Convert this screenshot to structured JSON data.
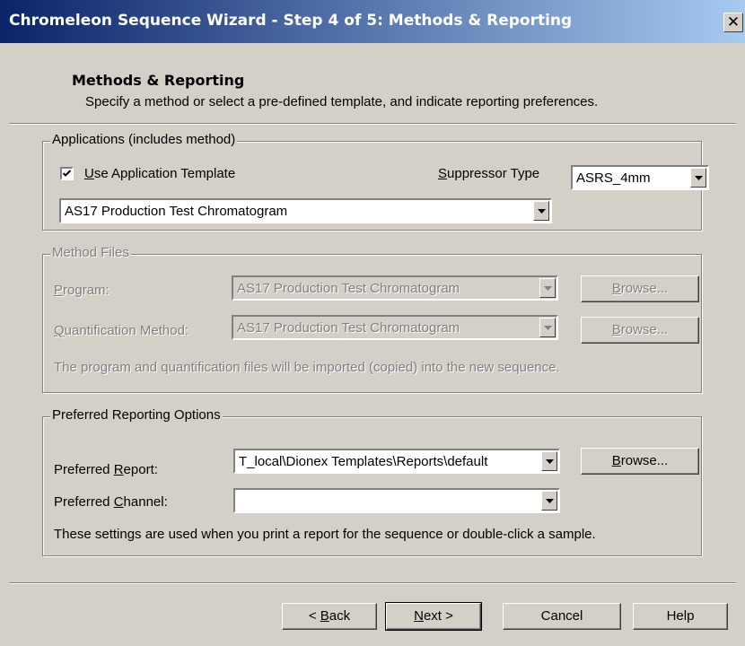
{
  "window": {
    "title": "Chromeleon Sequence Wizard - Step 4 of 5: Methods & Reporting",
    "close_glyph": "✕"
  },
  "header": {
    "title": "Methods & Reporting",
    "subtitle": "Specify a method or select a pre-defined template, and indicate reporting preferences."
  },
  "applications": {
    "legend": "Applications (includes method)",
    "use_template_label_u": "U",
    "use_template_label_rest": "se Application Template",
    "use_template_checked": true,
    "suppressor_label_u": "S",
    "suppressor_label_rest": "uppressor Type",
    "suppressor_value": "ASRS_4mm",
    "template_value": "AS17 Production Test Chromatogram"
  },
  "method_files": {
    "legend": "Method Files",
    "program_label_u": "P",
    "program_label_rest": "rogram:",
    "program_value": "AS17 Production Test Chromatogram",
    "quant_label_u": "Q",
    "quant_label_rest": "uantification Method:",
    "quant_value": "AS17 Production Test Chromatogram",
    "browse_u": "B",
    "browse_rest": "rowse...",
    "note": "The program and quantification files will be imported (copied) into the new sequence."
  },
  "reporting": {
    "legend": "Preferred Reporting Options",
    "report_label_pre": "Preferred ",
    "report_label_u": "R",
    "report_label_rest": "eport:",
    "report_value": "T_local\\Dionex Templates\\Reports\\default",
    "channel_label_pre": "Preferred ",
    "channel_label_u": "C",
    "channel_label_rest": "hannel:",
    "channel_value": "",
    "browse_u": "B",
    "browse_rest": "rowse...",
    "note": "These settings are used when you print a report for the sequence or double-click a sample."
  },
  "footer": {
    "back_pre": "< ",
    "back_u": "B",
    "back_rest": "ack",
    "next_u": "N",
    "next_rest": "ext >",
    "cancel": "Cancel",
    "help": "Help"
  }
}
